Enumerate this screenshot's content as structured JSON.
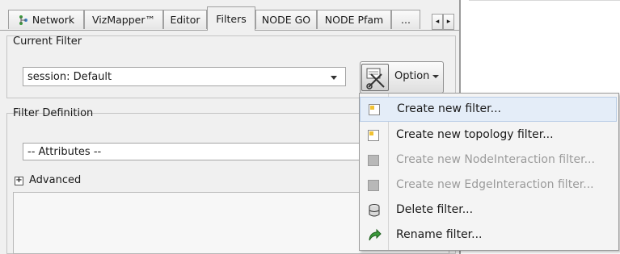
{
  "tabs": [
    {
      "label": "Network",
      "active": false
    },
    {
      "label": "VizMapper™",
      "active": false
    },
    {
      "label": "Editor",
      "active": false
    },
    {
      "label": "Filters",
      "active": true
    },
    {
      "label": "NODE GO",
      "active": false
    },
    {
      "label": "NODE Pfam",
      "active": false
    },
    {
      "label": "...",
      "active": false
    }
  ],
  "current_filter": {
    "group_label": "Current Filter",
    "selected": "session: Default",
    "option_button_label": "Option"
  },
  "filter_definition": {
    "group_label": "Filter Definition",
    "attributes_selected": "-- Attributes --",
    "advanced_label": "Advanced"
  },
  "option_menu": {
    "items": [
      {
        "label": "Create new filter...",
        "enabled": true,
        "icon": "new-filter-icon"
      },
      {
        "label": "Create new topology filter...",
        "enabled": true,
        "icon": "new-topology-filter-icon"
      },
      {
        "label": "Create new NodeInteraction filter...",
        "enabled": false,
        "icon": "node-interaction-icon"
      },
      {
        "label": "Create new EdgeInteraction filter...",
        "enabled": false,
        "icon": "edge-interaction-icon"
      },
      {
        "label": "Delete filter...",
        "enabled": true,
        "icon": "delete-icon"
      },
      {
        "label": "Rename filter...",
        "enabled": true,
        "icon": "rename-icon"
      }
    ]
  },
  "colors": {
    "panel_bg": "#f0f0f0",
    "menu_hover": "#e4edf8",
    "disabled_text": "#9b9b9b"
  }
}
